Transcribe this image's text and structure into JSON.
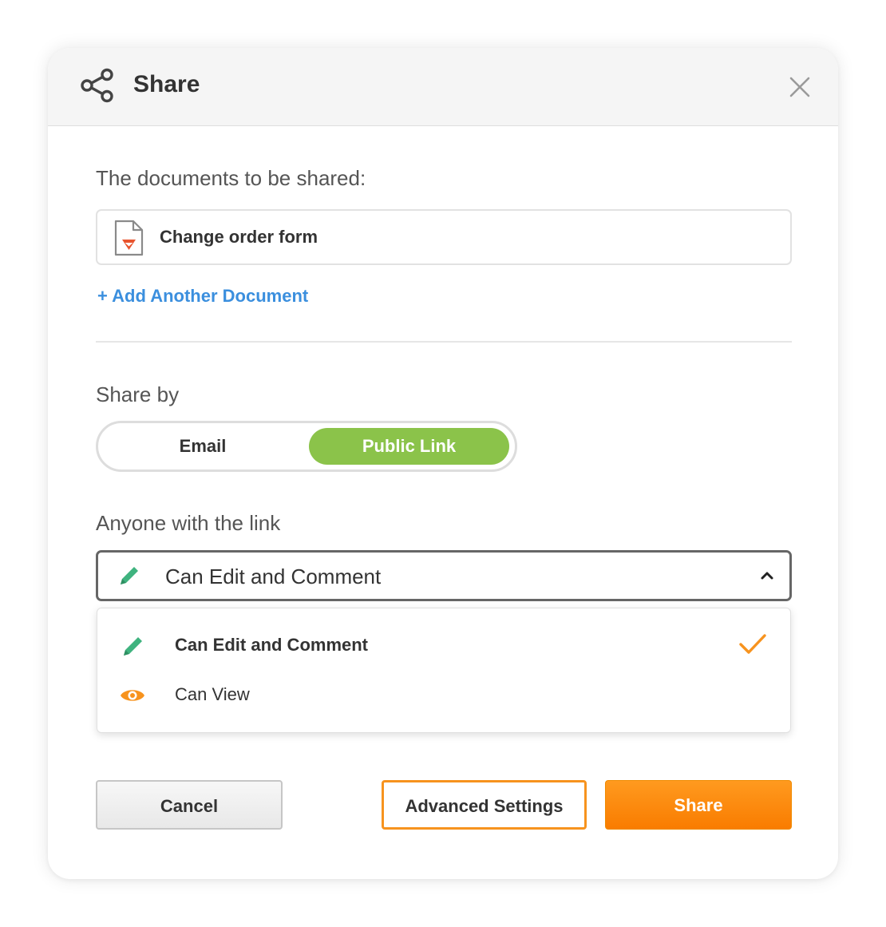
{
  "header": {
    "title": "Share",
    "share_icon": "share-icon",
    "close_icon": "close-icon"
  },
  "documents": {
    "label": "The documents to be shared:",
    "items": [
      {
        "name": "Change order form",
        "icon": "pdf-document-icon"
      }
    ],
    "add_link": "+ Add Another Document"
  },
  "share_by": {
    "label": "Share by",
    "options": [
      "Email",
      "Public Link"
    ],
    "selected": "Public Link"
  },
  "permission": {
    "label": "Anyone with the link",
    "selected": "Can Edit and Comment",
    "options": [
      {
        "label": "Can Edit and Comment",
        "icon": "pencil-icon",
        "selected": true
      },
      {
        "label": "Can View",
        "icon": "eye-icon",
        "selected": false
      }
    ]
  },
  "buttons": {
    "cancel": "Cancel",
    "advanced": "Advanced Settings",
    "share": "Share"
  },
  "colors": {
    "accent_orange": "#f7931e",
    "toggle_green": "#8bc34a",
    "link_blue": "#3b8fde",
    "pencil_green": "#3fb37f"
  }
}
